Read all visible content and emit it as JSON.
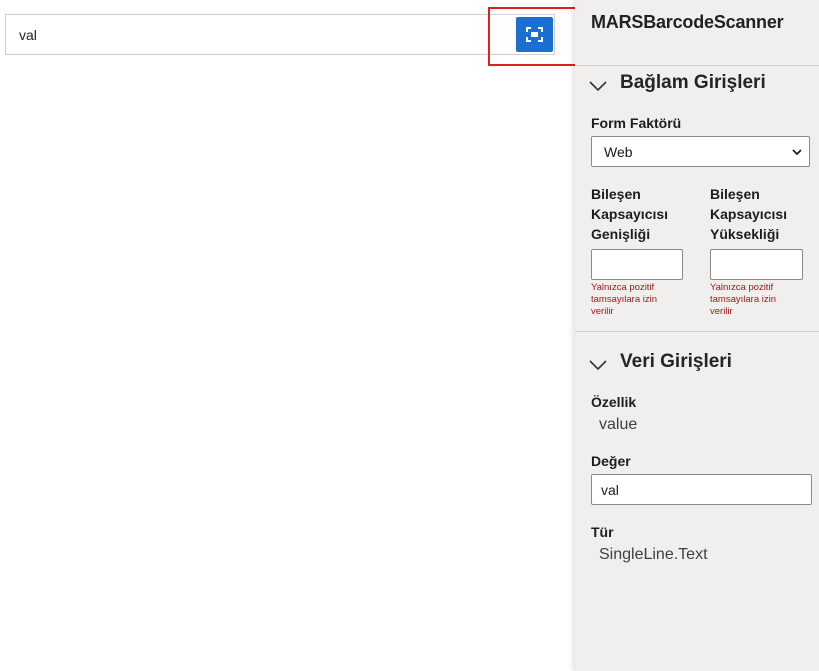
{
  "component": {
    "input_value": "val",
    "scan_icon": "barcode-scan-icon",
    "accent_color": "#1a6fd0",
    "highlight_color": "#e0201c"
  },
  "panel": {
    "title": "MARSBarcodeScanner",
    "context_section": {
      "title": "Bağlam Girişleri",
      "icon": "chevron-down-icon",
      "form_factor_label": "Form Faktörü",
      "form_factor_value": "Web",
      "width_label": [
        "Bileşen",
        "Kapsayıcısı",
        "Genişliği"
      ],
      "height_label": [
        "Bileşen",
        "Kapsayıcısı",
        "Yüksekliği"
      ],
      "width_value": "",
      "height_value": "",
      "width_error": "Yalnızca pozitif tamsayılara izin verilir",
      "height_error": "Yalnızca pozitif tamsayılara izin verilir"
    },
    "data_section": {
      "title": "Veri Girişleri",
      "icon": "chevron-down-icon",
      "property_label": "Özellik",
      "property_value": "value",
      "value_label": "Değer",
      "value_value": "val",
      "type_label": "Tür",
      "type_value": "SingleLine.Text"
    }
  }
}
